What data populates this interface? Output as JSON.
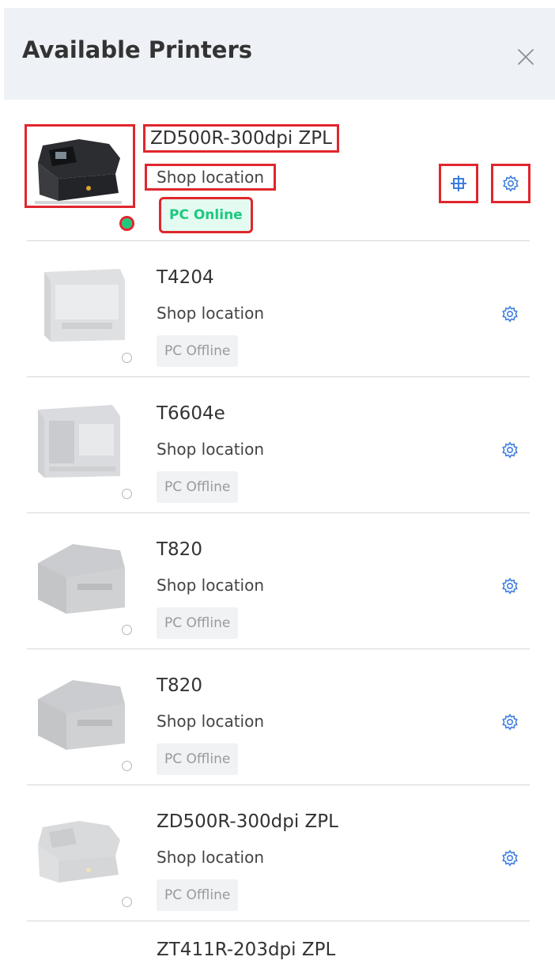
{
  "panel": {
    "title": "Available Printers",
    "close_icon": "close-icon"
  },
  "colors": {
    "online_green": "#1ec97e",
    "online_badge_bg": "#e4fbf2",
    "offline_badge_bg": "#f1f2f4",
    "accent_blue": "#3b7ddd",
    "highlight_red": "#e0262c"
  },
  "printers": [
    {
      "name": "ZD500R-300dpi ZPL",
      "location": "Shop location",
      "status": "PC Online",
      "online": true
    },
    {
      "name": "T4204",
      "location": "Shop location",
      "status": "PC Offline",
      "online": false
    },
    {
      "name": "T6604e",
      "location": "Shop location",
      "status": "PC Offline",
      "online": false
    },
    {
      "name": "T820",
      "location": "Shop location",
      "status": "PC Offline",
      "online": false
    },
    {
      "name": "T820",
      "location": "Shop location",
      "status": "PC Offline",
      "online": false
    },
    {
      "name": "ZD500R-300dpi ZPL",
      "location": "Shop location",
      "status": "PC Offline",
      "online": false
    },
    {
      "name": "ZT411R-203dpi ZPL",
      "location": "",
      "status": "",
      "online": false
    }
  ],
  "icons": {
    "thumbnail": "printer-thumbnail",
    "crosshair": "crosshair-icon",
    "settings": "gear-icon"
  }
}
